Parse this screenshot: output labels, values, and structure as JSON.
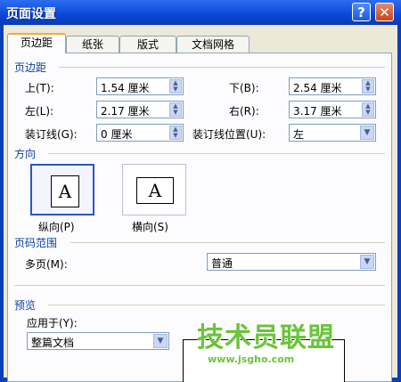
{
  "window": {
    "title": "页面设置",
    "help_glyph": "?",
    "close_glyph": "✕"
  },
  "tabs": [
    {
      "label": "页边距",
      "active": true
    },
    {
      "label": "纸张",
      "active": false
    },
    {
      "label": "版式",
      "active": false
    },
    {
      "label": "文档网格",
      "active": false
    }
  ],
  "margins": {
    "heading": "页边距",
    "top": {
      "label": "上(T):",
      "value": "1.54 厘米"
    },
    "bottom": {
      "label": "下(B):",
      "value": "2.54 厘米"
    },
    "left": {
      "label": "左(L):",
      "value": "2.17 厘米"
    },
    "right": {
      "label": "右(R):",
      "value": "3.17 厘米"
    },
    "gutter": {
      "label": "装订线(G):",
      "value": "0 厘米"
    },
    "gutter_pos": {
      "label": "装订线位置(U):",
      "value": "左"
    }
  },
  "orientation": {
    "heading": "方向",
    "portrait": {
      "label": "纵向(P)",
      "selected": true,
      "glyph": "A"
    },
    "landscape": {
      "label": "横向(S)",
      "selected": false,
      "glyph": "A"
    }
  },
  "pages": {
    "heading": "页码范围",
    "label": "多页(M):",
    "value": "普通"
  },
  "preview": {
    "heading": "预览",
    "apply_label": "应用于(Y):",
    "apply_value": "整篇文档"
  },
  "watermark": {
    "text": "技术员联盟",
    "url": "www.jsgho.com"
  }
}
